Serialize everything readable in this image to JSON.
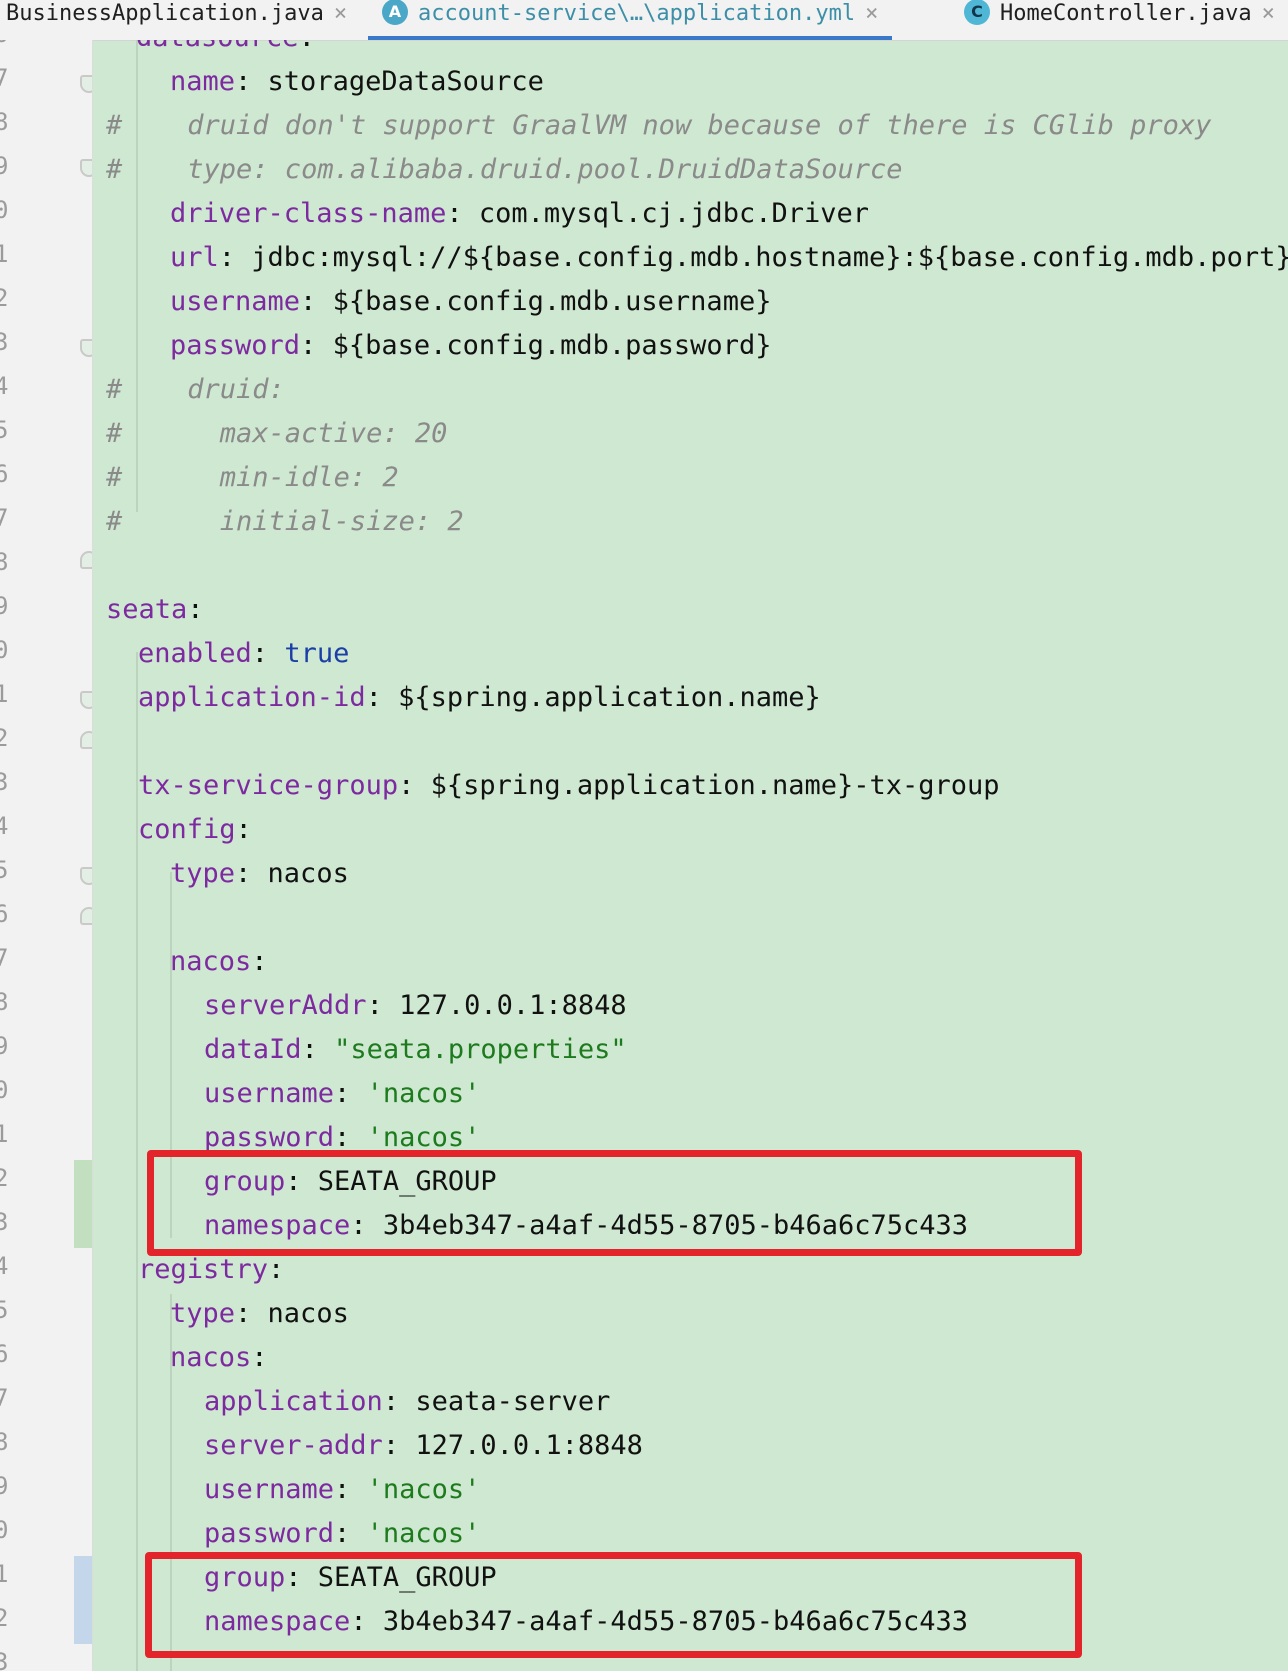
{
  "tabs": [
    {
      "label": "BusinessApplication.java",
      "icon": "java-class-icon",
      "active": false
    },
    {
      "label": "account-service\\…\\application.yml",
      "icon": "yaml-file-icon",
      "icon_glyph": "A",
      "active": true
    },
    {
      "label": "HomeController.java",
      "icon": "java-class-icon",
      "icon_glyph": "C",
      "active": false
    }
  ],
  "tab_close_glyph": "×",
  "gutter": {
    "line_numbers": [
      "6",
      "7",
      "8",
      "9",
      "0",
      "1",
      "2",
      "3",
      "4",
      "5",
      "6",
      "7",
      "8",
      "9",
      "0",
      "1",
      "2",
      "3",
      "4",
      "5",
      "6",
      "7",
      "8",
      "9",
      "0",
      "1",
      "2",
      "3",
      "4",
      "5",
      "6",
      "7",
      "8",
      "9",
      "0",
      "1",
      "2",
      "3"
    ]
  },
  "code": {
    "l0": {
      "key": "datasource",
      "sep": ":"
    },
    "l1": {
      "key": "name",
      "sep": ": ",
      "value": "storageDataSource"
    },
    "l2": {
      "comment": "#    druid don't support GraalVM now because of there is CGlib proxy"
    },
    "l3": {
      "comment": "#    type: com.alibaba.druid.pool.DruidDataSource"
    },
    "l4": {
      "key": "driver-class-name",
      "sep": ": ",
      "value": "com.mysql.cj.jdbc.Driver"
    },
    "l5": {
      "key": "url",
      "sep": ": ",
      "value": "jdbc:mysql://${base.config.mdb.hostname}:${base.config.mdb.port}"
    },
    "l6": {
      "key": "username",
      "sep": ": ",
      "value": "${base.config.mdb.username}"
    },
    "l7": {
      "key": "password",
      "sep": ": ",
      "value": "${base.config.mdb.password}"
    },
    "l8": {
      "comment": "#    druid:"
    },
    "l9": {
      "comment": "#      max-active: 20"
    },
    "l10": {
      "comment": "#      min-idle: 2"
    },
    "l11": {
      "comment": "#      initial-size: 2"
    },
    "l13": {
      "key": "seata",
      "sep": ":"
    },
    "l14": {
      "key": "enabled",
      "sep": ": ",
      "value": "true"
    },
    "l15": {
      "key": "application-id",
      "sep": ": ",
      "value": "${spring.application.name}"
    },
    "l17": {
      "key": "tx-service-group",
      "sep": ": ",
      "value": "${spring.application.name}-tx-group"
    },
    "l18": {
      "key": "config",
      "sep": ":"
    },
    "l19": {
      "key": "type",
      "sep": ": ",
      "value": "nacos"
    },
    "l21": {
      "key": "nacos",
      "sep": ":"
    },
    "l22": {
      "key": "serverAddr",
      "sep": ": ",
      "value": "127.0.0.1:8848"
    },
    "l23": {
      "key": "dataId",
      "sep": ": ",
      "value": "\"seata.properties\""
    },
    "l24": {
      "key": "username",
      "sep": ": ",
      "value": "'nacos'"
    },
    "l25": {
      "key": "password",
      "sep": ": ",
      "value": "'nacos'"
    },
    "l26": {
      "key": "group",
      "sep": ": ",
      "value": "SEATA_GROUP"
    },
    "l27": {
      "key": "namespace",
      "sep": ": ",
      "value": "3b4eb347-a4af-4d55-8705-b46a6c75c433"
    },
    "l28": {
      "key": "registry",
      "sep": ":"
    },
    "l29": {
      "key": "type",
      "sep": ": ",
      "value": "nacos"
    },
    "l30": {
      "key": "nacos",
      "sep": ":"
    },
    "l31": {
      "key": "application",
      "sep": ": ",
      "value": "seata-server"
    },
    "l32": {
      "key": "server-addr",
      "sep": ": ",
      "value": "127.0.0.1:8848"
    },
    "l33": {
      "key": "username",
      "sep": ": ",
      "value": "'nacos'"
    },
    "l34": {
      "key": "password",
      "sep": ": ",
      "value": "'nacos'"
    },
    "l35": {
      "key": "group",
      "sep": ": ",
      "value": "SEATA_GROUP"
    },
    "l36": {
      "key": "namespace",
      "sep": ": ",
      "value": "3b4eb347-a4af-4d55-8705-b46a6c75c433"
    }
  },
  "colors": {
    "editor_background": "#cfe8d1",
    "yaml_key": "#7d2aa0",
    "string_value": "#1d7a1d",
    "boolean_value": "#1a3fa6",
    "comment": "#8a8a8a",
    "annotation_box": "#e3242b",
    "active_tab_text": "#3d8fa8",
    "active_tab_underline": "#3a78c9"
  }
}
